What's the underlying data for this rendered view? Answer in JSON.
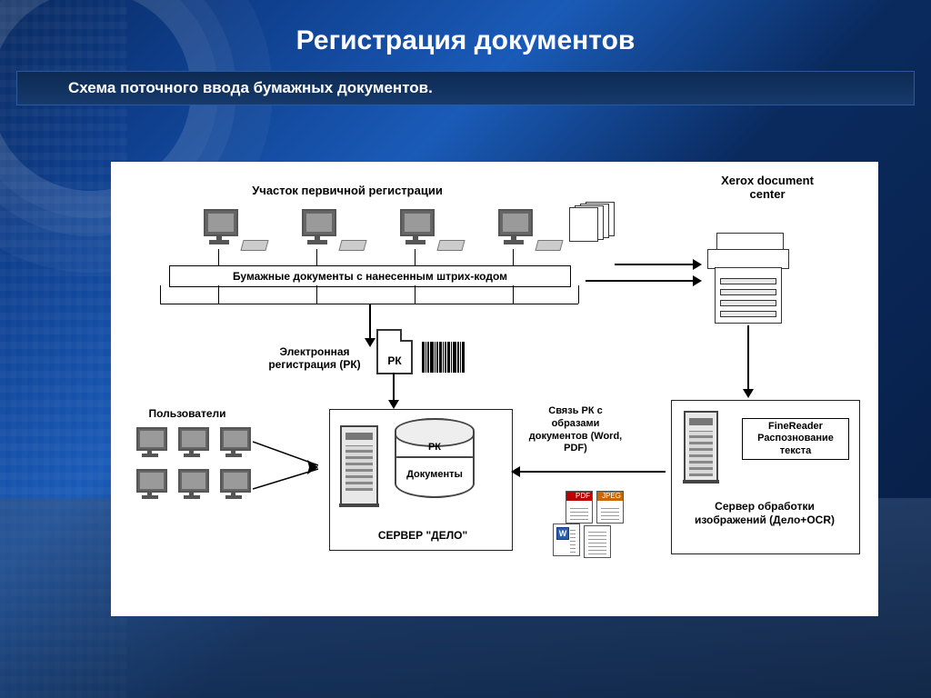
{
  "title": "Регистрация документов",
  "subtitle": "Схема поточного ввода бумажных документов.",
  "labels": {
    "primary_reg": "Участок первичной регистрации",
    "xerox": "Xerox document center",
    "banner": "Бумажные документы с нанесенным штрих-кодом",
    "ereg": "Электронная регистрация (РК)",
    "rk_page": "РК",
    "users": "Пользователи",
    "db_top": "РК",
    "db_bottom": "Документы",
    "server_delo": "СЕРВЕР \"ДЕЛО\"",
    "link_rk": "Связь РК с образами документов (Word, PDF)",
    "finereader": "FineReader Распознование текста",
    "ocr_server": "Сервер обработки изображений (Дело+OCR)",
    "pdf": "PDF",
    "jpeg": "JPEG",
    "w": "W"
  }
}
